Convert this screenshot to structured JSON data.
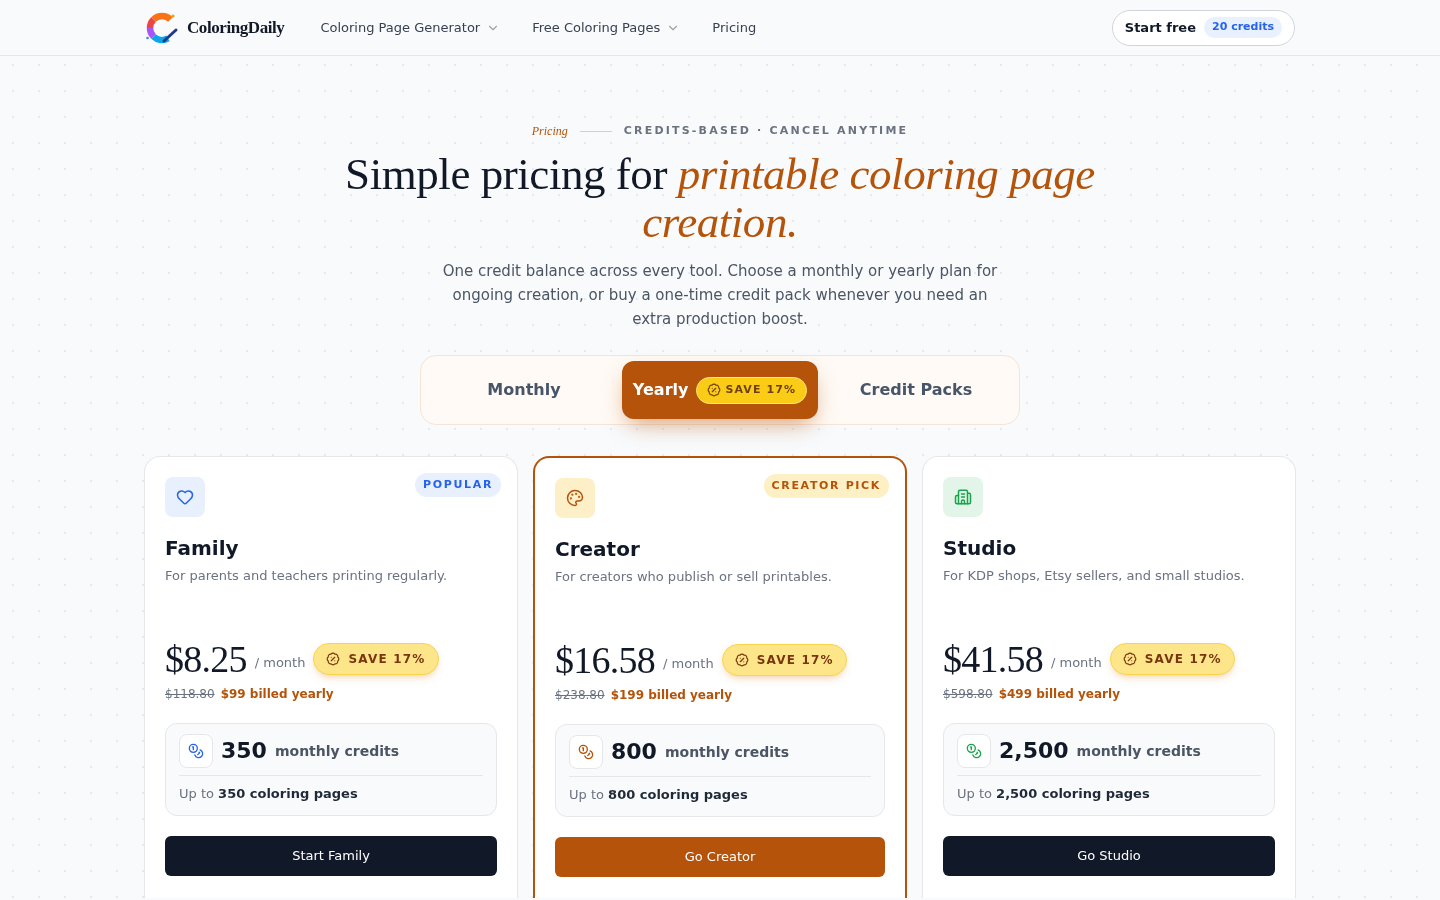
{
  "header": {
    "logo": "ColoringDaily",
    "nav": [
      {
        "label": "Coloring Page Generator",
        "dropdown": true
      },
      {
        "label": "Free Coloring Pages",
        "dropdown": true
      },
      {
        "label": "Pricing",
        "dropdown": false
      }
    ],
    "cta": {
      "label": "Start free",
      "badge": "20 credits"
    }
  },
  "hero": {
    "eyebrow": "Pricing",
    "tagline": "CREDITS-BASED · CANCEL ANYTIME",
    "title": "Simple pricing for *printable coloring page creation.*",
    "subtitle": "One credit balance across every tool. Choose a monthly or yearly plan for ongoing creation, or buy a one-time credit pack whenever you need an extra production boost."
  },
  "billing_tabs": [
    {
      "label": "Monthly",
      "selected": false
    },
    {
      "label": "Yearly",
      "selected": true,
      "badge": "SAVE 17%"
    },
    {
      "label": "Credit Packs",
      "selected": false
    }
  ],
  "plans": [
    {
      "name": "Family",
      "badge": "POPULAR",
      "description": "For parents and teachers printing regularly.",
      "highlighted": false,
      "price": "$8.25",
      "period": "/ month",
      "save": "SAVE 17%",
      "original_price": "$118.80",
      "billed": "$99 billed yearly",
      "credits": "350",
      "credits_label": "monthly credits",
      "pages": "Up to **350 coloring pages**",
      "button": "Start Family"
    },
    {
      "name": "Creator",
      "badge": "CREATOR PICK",
      "description": "For creators who publish or sell printables.",
      "highlighted": true,
      "price": "$16.58",
      "period": "/ month",
      "save": "SAVE 17%",
      "original_price": "$238.80",
      "billed": "$199 billed yearly",
      "credits": "800",
      "credits_label": "monthly credits",
      "pages": "Up to **800 coloring pages**",
      "button": "Go Creator"
    },
    {
      "name": "Studio",
      "description": "For KDP shops, Etsy sellers, and small studios.",
      "highlighted": false,
      "price": "$41.58",
      "period": "/ month",
      "save": "SAVE 17%",
      "original_price": "$598.80",
      "billed": "$499 billed yearly",
      "credits": "2,500",
      "credits_label": "monthly credits",
      "pages": "Up to **2,500 coloring pages**",
      "button": "Go Studio"
    }
  ]
}
